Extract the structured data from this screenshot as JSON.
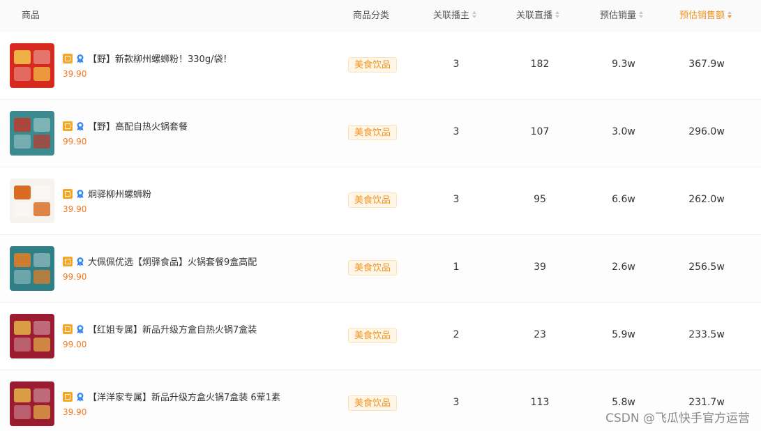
{
  "header": {
    "product": "商品",
    "category": "商品分类",
    "anchors": "关联播主",
    "lives": "关联直播",
    "volume": "预估销量",
    "sales": "预估销售额"
  },
  "rows": [
    {
      "title": "【野】新款柳州螺蛳粉！330g/袋！",
      "price": "39.90",
      "category": "美食饮品",
      "anchors": "3",
      "lives": "182",
      "volume": "9.3w",
      "sales": "367.9w",
      "thumb_colors": [
        "#d62a1e",
        "#f2c94c"
      ]
    },
    {
      "title": "【野】高配自热火锅套餐",
      "price": "99.90",
      "category": "美食饮品",
      "anchors": "3",
      "lives": "107",
      "volume": "3.0w",
      "sales": "296.0w",
      "thumb_colors": [
        "#3a8a8f",
        "#c0392b"
      ]
    },
    {
      "title": "炯驿柳州螺蛳粉",
      "price": "39.90",
      "category": "美食饮品",
      "anchors": "3",
      "lives": "95",
      "volume": "6.6w",
      "sales": "262.0w",
      "thumb_colors": [
        "#f7f3ee",
        "#d35400"
      ]
    },
    {
      "title": "大佩佩优选【炯驿食品】火锅套餐9盒高配",
      "price": "99.90",
      "category": "美食饮品",
      "anchors": "1",
      "lives": "39",
      "volume": "2.6w",
      "sales": "256.5w",
      "thumb_colors": [
        "#2f7f86",
        "#e67e22"
      ]
    },
    {
      "title": "【红姐专属】新品升级方盒自热火锅7盒装",
      "price": "99.00",
      "category": "美食饮品",
      "anchors": "2",
      "lives": "23",
      "volume": "5.9w",
      "sales": "233.5w",
      "thumb_colors": [
        "#9b1b30",
        "#e6b34a"
      ]
    },
    {
      "title": "【洋洋家专属】新品升级方盒火锅7盒装 6荤1素",
      "price": "39.90",
      "category": "美食饮品",
      "anchors": "3",
      "lives": "113",
      "volume": "5.8w",
      "sales": "231.7w",
      "thumb_colors": [
        "#9b1b30",
        "#e6b34a"
      ]
    }
  ],
  "watermark": "CSDN @飞瓜快手官方运营",
  "colors": {
    "accent": "#f0921e",
    "price": "#f0781e"
  }
}
